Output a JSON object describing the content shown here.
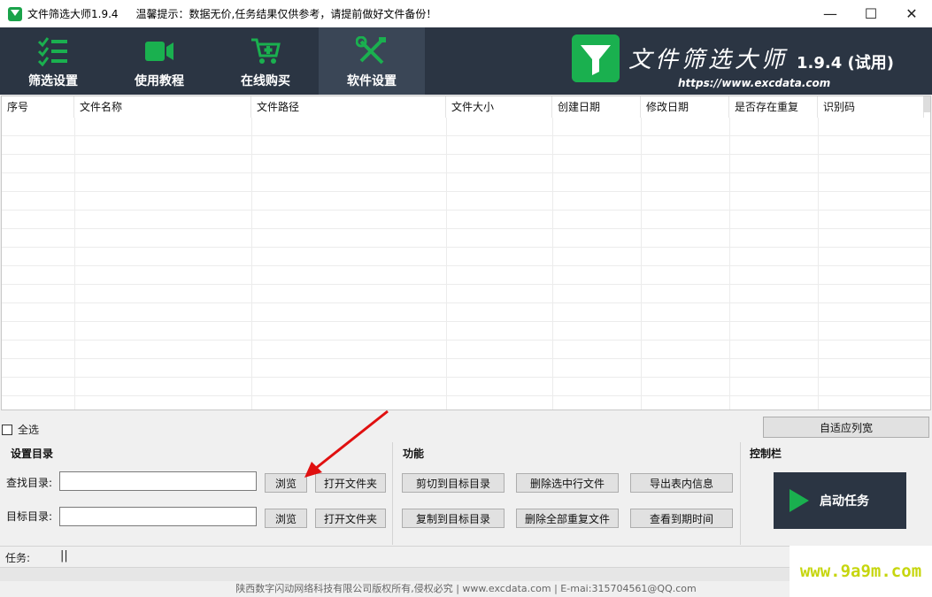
{
  "window": {
    "title": "文件筛选大师1.9.4",
    "hint": "温馨提示：数据无价,任务结果仅供参考，请提前做好文件备份！",
    "controls": {
      "minimize": "—",
      "maximize": "☐",
      "close": "✕"
    }
  },
  "toolbar": {
    "items": [
      {
        "label": "筛选设置",
        "icon": "checklist-icon"
      },
      {
        "label": "使用教程",
        "icon": "video-camera-icon"
      },
      {
        "label": "在线购买",
        "icon": "cart-icon"
      },
      {
        "label": "软件设置",
        "icon": "tools-icon"
      }
    ],
    "active_index": 3
  },
  "brand": {
    "title": "文件筛选大师",
    "version": "1.9.4",
    "edition": "(试用)",
    "url": "https://www.excdata.com"
  },
  "table": {
    "columns": [
      "序号",
      "文件名称",
      "文件路径",
      "文件大小",
      "创建日期",
      "修改日期",
      "是否存在重复",
      "识别码"
    ]
  },
  "select_all_label": "全选",
  "autofit_button": "自适应列宽",
  "directories": {
    "title": "设置目录",
    "search_label": "查找目录:",
    "search_value": "",
    "target_label": "目标目录:",
    "target_value": "",
    "browse": "浏览",
    "open_folder": "打开文件夹"
  },
  "functions": {
    "title": "功能",
    "cut_to_target": "剪切到目标目录",
    "delete_selected": "删除选中行文件",
    "export_table": "导出表内信息",
    "copy_to_target": "复制到目标目录",
    "delete_all_duplicates": "删除全部重复文件",
    "check_expiry": "查看到期时间"
  },
  "control": {
    "title": "控制栏",
    "start_label": "启动任务"
  },
  "status": {
    "task_label": "任务:",
    "task_value": "||"
  },
  "footer": "陕西数字闪动网络科技有限公司版权所有,侵权必究 | www.excdata.com | E-mai:315704561@QQ.com",
  "watermark": "www.9a9m.com",
  "colors": {
    "toolbar_bg": "#2b3543",
    "toolbar_active": "#3a4656",
    "accent_green": "#1ab04f",
    "watermark": "#c6d60e"
  }
}
